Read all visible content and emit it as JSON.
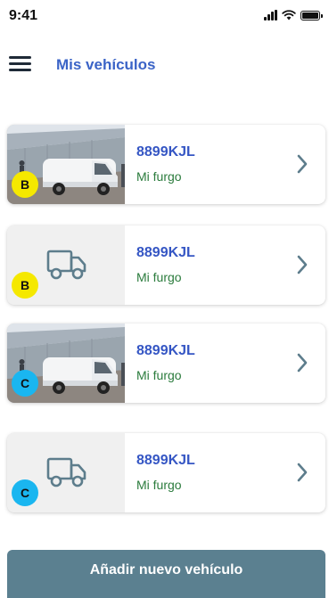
{
  "status_bar": {
    "time": "9:41",
    "icons": [
      "signal-icon",
      "wifi-icon",
      "battery-icon"
    ]
  },
  "header": {
    "menu_icon": "hamburger-menu-icon",
    "title": "Mis vehículos"
  },
  "vehicles": [
    {
      "plate": "8899KJL",
      "nickname": "Mi furgo",
      "category": "B",
      "thumbnail": "photo"
    },
    {
      "plate": "8899KJL",
      "nickname": "Mi furgo",
      "category": "B",
      "thumbnail": "truck-icon"
    },
    {
      "plate": "8899KJL",
      "nickname": "Mi furgo",
      "category": "C",
      "thumbnail": "photo"
    },
    {
      "plate": "8899KJL",
      "nickname": "Mi furgo",
      "category": "C",
      "thumbnail": "truck-icon"
    }
  ],
  "add_button": {
    "label": "Añadir nuevo vehículo"
  },
  "colors": {
    "title_blue": "#3b64c7",
    "plate_blue": "#3556c4",
    "nickname_green": "#2a7b3c",
    "badge_b_yellow": "#f5e800",
    "badge_c_cyan": "#1ab6f0",
    "button_slate": "#5b8090",
    "icon_slate": "#5d7d8c"
  }
}
